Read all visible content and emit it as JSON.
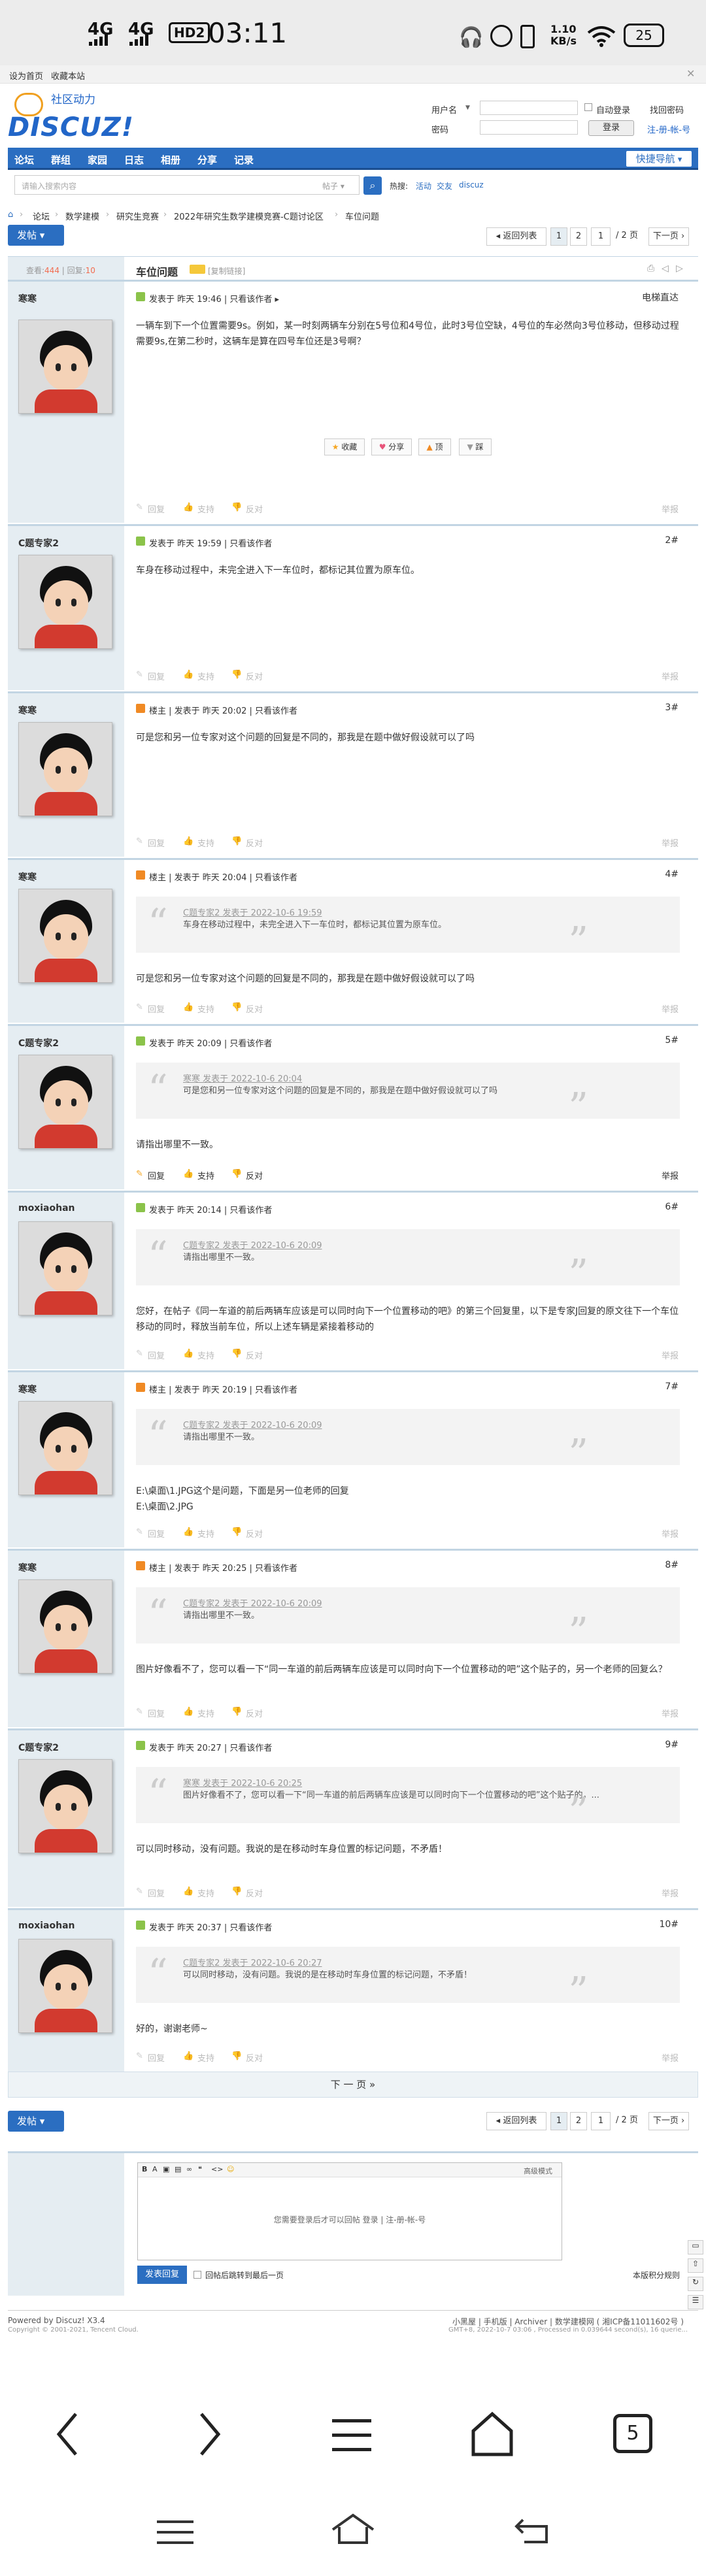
{
  "status_bar": {
    "signal1": "4G",
    "signal2": "4G",
    "hd": "HD2",
    "time": "03:11",
    "net_speed": "1.10 KB/s",
    "battery": "25"
  },
  "topbar": {
    "set_home": "设为首页",
    "bookmark": "收藏本站"
  },
  "header": {
    "logo": "DISCUZ!",
    "logo_sub": "社区动力",
    "username_label": "用户名",
    "password_label": "密码",
    "auto_login": "自动登录",
    "forgot": "找回密码",
    "login_btn": "登录",
    "register": "注-册-帐-号"
  },
  "nav": {
    "items": [
      "论坛",
      "群组",
      "家园",
      "日志",
      "相册",
      "分享",
      "记录"
    ],
    "quick": "快捷导航"
  },
  "search": {
    "placeholder": "请输入搜索内容",
    "type": "帖子",
    "hot_label": "热搜:",
    "hot": [
      "活动",
      "交友",
      "discuz"
    ]
  },
  "breadcrumb": [
    "论坛",
    "数学建模",
    "研究生竞赛",
    "2022年研究生数学建模竞赛-C题讨论区",
    "车位问题"
  ],
  "toolbar": {
    "post": "发帖",
    "back": "返回列表",
    "pages": [
      "1",
      "2"
    ],
    "page_input": "1",
    "page_total": "/ 2 页",
    "next": "下一页"
  },
  "thread": {
    "views_label": "查看:",
    "views": "444",
    "replies_label": "回复:",
    "replies": "10",
    "title": "车位问题",
    "copy_link": "[复制链接]"
  },
  "posts": [
    {
      "author": "寒寒",
      "meta": "发表于 昨天 19:46 | 只看该作者 ▸",
      "floor": "电梯直达",
      "content": "一辆车到下一个位置需要9s。例如，某一时刻两辆车分别在5号位和4号位，此时3号位空缺，4号位的车必然向3号位移动，但移动过程需要9s,在第二秒时，这辆车是算在四号车位还是3号啊？",
      "buttons": [
        "收藏",
        "分享",
        "顶",
        "踩"
      ]
    },
    {
      "author": "C题专家2",
      "meta": "发表于 昨天 19:59 | 只看该作者",
      "floor": "2#",
      "content": "车身在移动过程中，未完全进入下一车位时，都标记其位置为原车位。"
    },
    {
      "author": "寒寒",
      "meta": "楼主 | 发表于 昨天 20:02 | 只看该作者",
      "floor": "3#",
      "content": "可是您和另一位专家对这个问题的回复是不同的，那我是在题中做好假设就可以了吗"
    },
    {
      "author": "寒寒",
      "meta": "楼主 | 发表于 昨天 20:04 | 只看该作者",
      "floor": "4#",
      "quote_head": "C题专家2 发表于 2022-10-6 19:59",
      "quote": "车身在移动过程中，未完全进入下一车位时，都标记其位置为原车位。",
      "content": "可是您和另一位专家对这个问题的回复是不同的，那我是在题中做好假设就可以了吗"
    },
    {
      "author": "C题专家2",
      "meta": "发表于 昨天 20:09 | 只看该作者",
      "floor": "5#",
      "quote_head": "寒寒 发表于 2022-10-6 20:04",
      "quote": "可是您和另一位专家对这个问题的回复是不同的，那我是在题中做好假设就可以了吗",
      "content": "请指出哪里不一致。",
      "actions": [
        "回复",
        "支持",
        "反对"
      ],
      "report": "举报"
    },
    {
      "author": "moxiaohan",
      "meta": "发表于 昨天 20:14 | 只看该作者",
      "floor": "6#",
      "quote_head": "C题专家2 发表于 2022-10-6 20:09",
      "quote": "请指出哪里不一致。",
      "content": "您好，在帖子《同一车道的前后两辆车应该是可以同时向下一个位置移动的吧》的第三个回复里，以下是专家J回复的原文往下一个车位移动的同时，释放当前车位，所以上述车辆是紧接着移动的"
    },
    {
      "author": "寒寒",
      "meta": "楼主 | 发表于 昨天 20:19 | 只看该作者",
      "floor": "7#",
      "quote_head": "C题专家2 发表于 2022-10-6 20:09",
      "quote": "请指出哪里不一致。",
      "content": "E:\\桌面\\1.JPG这个是问题，下面是另一位老师的回复\nE:\\桌面\\2.JPG"
    },
    {
      "author": "寒寒",
      "meta": "楼主 | 发表于 昨天 20:25 | 只看该作者",
      "floor": "8#",
      "quote_head": "C题专家2 发表于 2022-10-6 20:09",
      "quote": "请指出哪里不一致。",
      "content": "图片好像看不了，您可以看一下“同一车道的前后两辆车应该是可以同时向下一个位置移动的吧”这个贴子的，另一个老师的回复么？"
    },
    {
      "author": "C题专家2",
      "meta": "发表于 昨天 20:27 | 只看该作者",
      "floor": "9#",
      "quote_head": "寒寒 发表于 2022-10-6 20:25",
      "quote": "图片好像看不了，您可以看一下“同一车道的前后两辆车应该是可以同时向下一个位置移动的吧”这个贴子的，...",
      "content": "可以同时移动，没有问题。我说的是在移动时车身位置的标记问题，不矛盾！"
    },
    {
      "author": "moxiaohan",
      "meta": "发表于 昨天 20:37 | 只看该作者",
      "floor": "10#",
      "quote_head": "C题专家2 发表于 2022-10-6 20:27",
      "quote": "可以同时移动，没有问题。我说的是在移动时车身位置的标记问题，不矛盾！",
      "content": "好的，谢谢老师~"
    }
  ],
  "post_actions": [
    "回复",
    "支持",
    "反对"
  ],
  "report": "举报",
  "next_page": "下 一 页 »",
  "reply": {
    "msg": "您需要登录后才可以回帖 登录 | 注-册-帐-号",
    "advanced": "高级模式",
    "submit": "发表回复",
    "back_to_last": "回帖后跳转到最后一页",
    "points": "本版积分规则"
  },
  "footer": {
    "powered": "Powered by Discuz! X3.4",
    "copyright": "Copyright © 2001-2021, Tencent Cloud.",
    "links": "小黑屋 | 手机版 | Archiver | 数学建模网 ( 湘ICP备11011602号 )",
    "gmt": "GMT+8, 2022-10-7 03:06 , Processed in 0.039644 second(s), 16 querie..."
  },
  "android_nav": {
    "tabs": "5"
  }
}
